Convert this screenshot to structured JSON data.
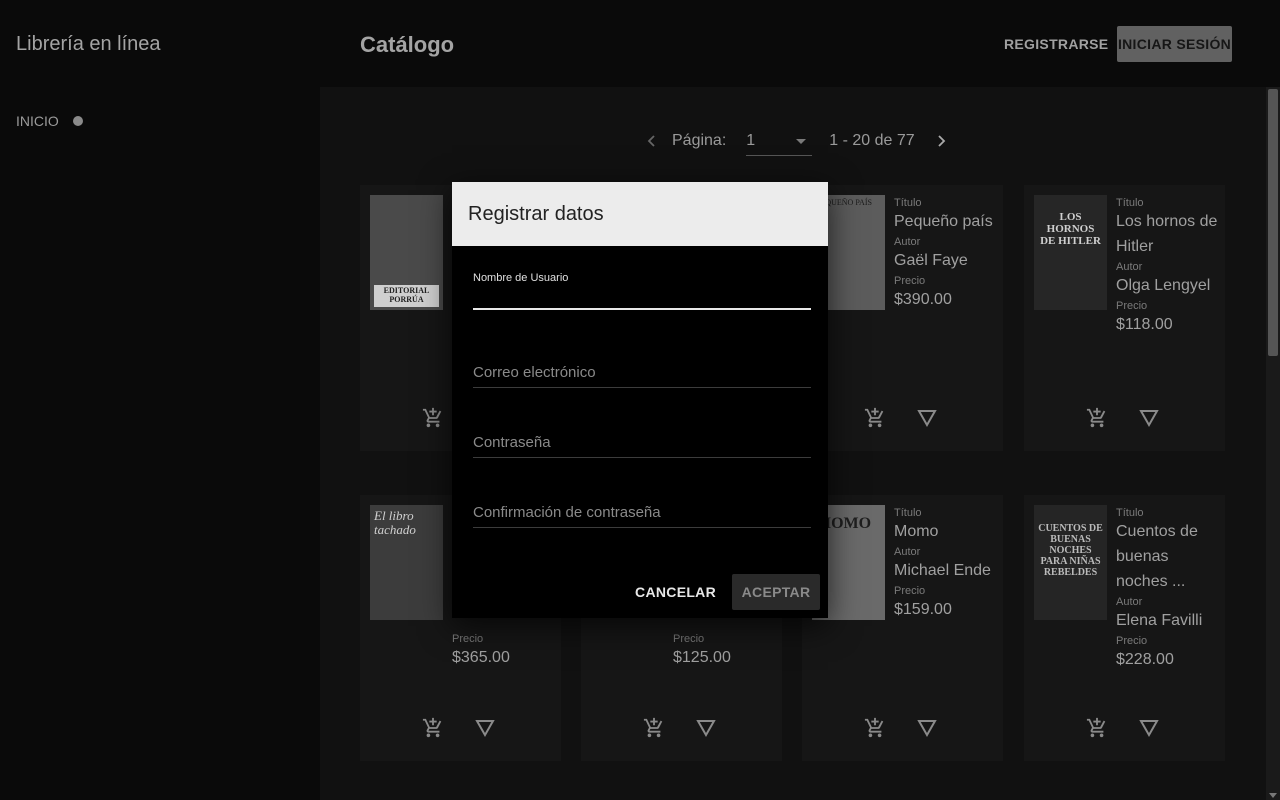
{
  "app": {
    "brand": "Librería en línea",
    "page_title": "Catálogo"
  },
  "header": {
    "register_label": "REGISTRARSE",
    "login_label": "INICIAR SESIÓN"
  },
  "sidebar": {
    "items": [
      {
        "label": "INICIO",
        "active": true
      }
    ]
  },
  "pager": {
    "label": "Página:",
    "selected_page": "1",
    "range": "1 - 20 de 77"
  },
  "labels": {
    "title": "Título",
    "author": "Autor",
    "price": "Precio"
  },
  "books": [
    {
      "cover_text": "EDITORIAL PORRÚA",
      "title": "",
      "author": "",
      "price": ""
    },
    {
      "cover_text": "",
      "title": "",
      "author": "",
      "price": ""
    },
    {
      "cover_text": "PEQUEÑO PAÍS",
      "title": "Pequeño país",
      "author": "Gaël Faye",
      "price": "$390.00"
    },
    {
      "cover_text": "LOS HORNOS DE HITLER",
      "title": "Los hornos de Hitler",
      "author": "Olga Lengyel",
      "price": "$118.00"
    },
    {
      "cover_text": "El libro tachado",
      "title": "",
      "author": "",
      "price": "$365.00"
    },
    {
      "cover_text": "",
      "title": "",
      "author": "",
      "price": "$125.00"
    },
    {
      "cover_text": "MOMO",
      "title": "Momo",
      "author": "Michael Ende",
      "price": "$159.00"
    },
    {
      "cover_text": "CUENTOS DE BUENAS NOCHES PARA NIÑAS REBELDES",
      "title": "Cuentos de buenas noches ...",
      "author": "Elena Favilli",
      "price": "$228.00"
    }
  ],
  "dialog": {
    "title": "Registrar datos",
    "fields": {
      "username": "Nombre de Usuario",
      "email": "Correo electrónico",
      "password": "Contraseña",
      "confirm": "Confirmación de contraseña"
    },
    "cancel": "CANCELAR",
    "accept": "ACEPTAR"
  }
}
